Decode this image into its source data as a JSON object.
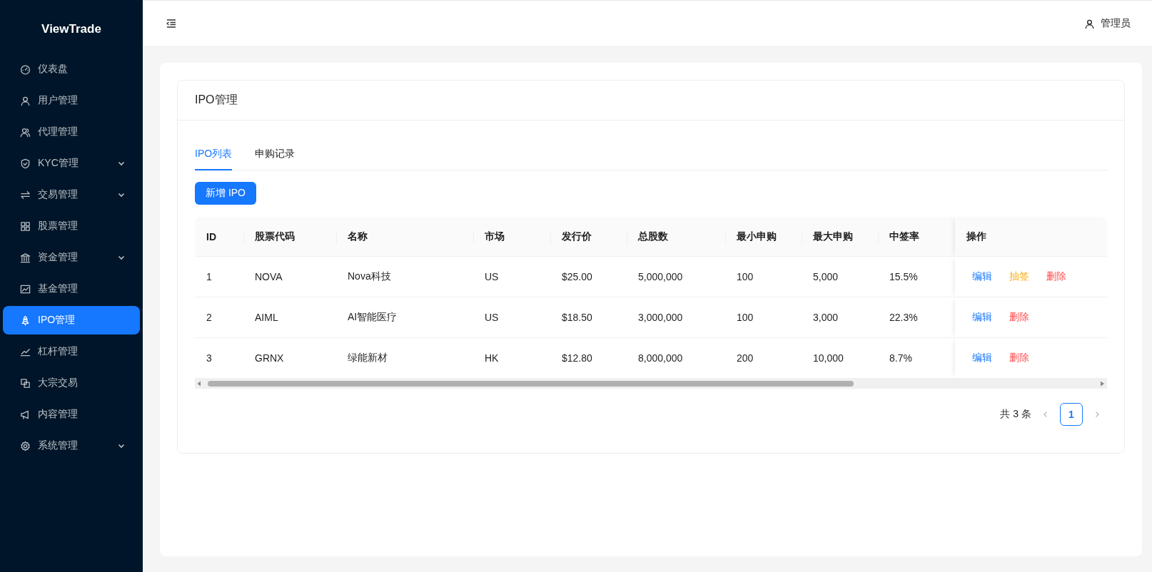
{
  "sidebar": {
    "logo": "ViewTrade",
    "items": [
      {
        "label": "仪表盘",
        "selected": false,
        "expandable": false
      },
      {
        "label": "用户管理",
        "selected": false,
        "expandable": false
      },
      {
        "label": "代理管理",
        "selected": false,
        "expandable": false
      },
      {
        "label": "KYC管理",
        "selected": false,
        "expandable": true
      },
      {
        "label": "交易管理",
        "selected": false,
        "expandable": true
      },
      {
        "label": "股票管理",
        "selected": false,
        "expandable": false
      },
      {
        "label": "资金管理",
        "selected": false,
        "expandable": true
      },
      {
        "label": "基金管理",
        "selected": false,
        "expandable": false
      },
      {
        "label": "IPO管理",
        "selected": true,
        "expandable": false
      },
      {
        "label": "杠杆管理",
        "selected": false,
        "expandable": false
      },
      {
        "label": "大宗交易",
        "selected": false,
        "expandable": false
      },
      {
        "label": "内容管理",
        "selected": false,
        "expandable": false
      },
      {
        "label": "系统管理",
        "selected": false,
        "expandable": true
      }
    ]
  },
  "header": {
    "user": "管理员"
  },
  "card": {
    "title": "IPO管理"
  },
  "tabs": [
    {
      "label": "IPO列表",
      "selected": true
    },
    {
      "label": "申购记录",
      "selected": false
    }
  ],
  "add_button": "新增 IPO",
  "table": {
    "columns": [
      "ID",
      "股票代码",
      "名称",
      "市场",
      "发行价",
      "总股数",
      "最小申购",
      "最大申购",
      "中签率",
      "操作"
    ],
    "rows": [
      {
        "cells": [
          "1",
          "NOVA",
          "Nova科技",
          "US",
          "$25.00",
          "5,000,000",
          "100",
          "5,000",
          "15.5%"
        ],
        "actions": [
          {
            "label": "编辑",
            "kind": "edit"
          },
          {
            "label": "抽签",
            "kind": "draw"
          },
          {
            "label": "删除",
            "kind": "delete"
          }
        ]
      },
      {
        "cells": [
          "2",
          "AIML",
          "AI智能医疗",
          "US",
          "$18.50",
          "3,000,000",
          "100",
          "3,000",
          "22.3%"
        ],
        "actions": [
          {
            "label": "编辑",
            "kind": "edit"
          },
          {
            "label": "删除",
            "kind": "delete"
          }
        ]
      },
      {
        "cells": [
          "3",
          "GRNX",
          "绿能新材",
          "HK",
          "$12.80",
          "8,000,000",
          "200",
          "10,000",
          "8.7%"
        ],
        "actions": [
          {
            "label": "编辑",
            "kind": "edit"
          },
          {
            "label": "删除",
            "kind": "delete"
          }
        ]
      }
    ]
  },
  "pagination": {
    "total": "共 3 条",
    "pages": [
      {
        "label": "1",
        "selected": true
      }
    ]
  }
}
